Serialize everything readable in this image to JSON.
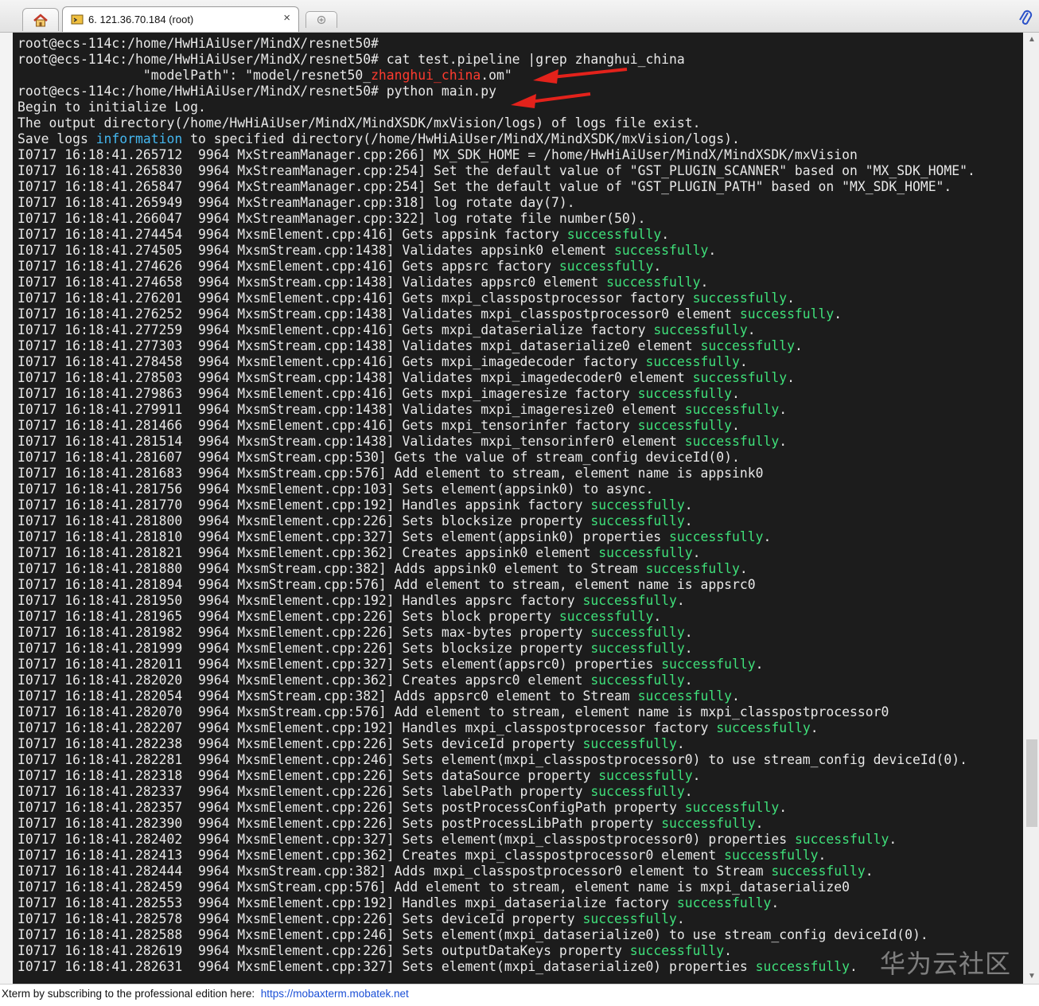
{
  "window": {
    "tabs": [
      {
        "label": "",
        "icon": "home-icon"
      },
      {
        "label": "6. 121.36.70.184 (root)",
        "icon": "terminal-icon",
        "close": "×"
      }
    ],
    "new_tab_icon": "new-tab-icon",
    "attach_icon": "paperclip-icon"
  },
  "colors": {
    "terminal_bg": "#1c1c1c",
    "text": "#e8e8e8",
    "success": "#3fe07a",
    "info": "#44b6ee",
    "highlight": "#ff3b2f",
    "arrow": "#e3221b"
  },
  "terminal": {
    "lines": [
      [
        {
          "t": "root@ecs-114c:/home/HwHiAiUser/MindX/resnet50#"
        }
      ],
      [
        {
          "t": "root@ecs-114c:/home/HwHiAiUser/MindX/resnet50# cat test.pipeline |grep zhanghui_china"
        }
      ],
      [
        {
          "t": "                \"modelPath\": \"model/resnet50_"
        },
        {
          "t": "zhanghui_china",
          "c": "red"
        },
        {
          "t": ".om\""
        }
      ],
      [
        {
          "t": "root@ecs-114c:/home/HwHiAiUser/MindX/resnet50# python main.py"
        }
      ],
      [
        {
          "t": "Begin to initialize Log."
        }
      ],
      [
        {
          "t": "The output directory(/home/HwHiAiUser/MindX/MindXSDK/mxVision/logs) of logs file exist."
        }
      ],
      [
        {
          "t": "Save logs "
        },
        {
          "t": "information",
          "c": "info"
        },
        {
          "t": " to specified directory(/home/HwHiAiUser/MindX/MindXSDK/mxVision/logs)."
        }
      ],
      [
        {
          "t": "I0717 16:18:41.265712  9964 MxStreamManager.cpp:266] MX_SDK_HOME = /home/HwHiAiUser/MindX/MindXSDK/mxVision"
        }
      ],
      [
        {
          "t": "I0717 16:18:41.265830  9964 MxStreamManager.cpp:254] Set the default value of \"GST_PLUGIN_SCANNER\" based on \"MX_SDK_HOME\"."
        }
      ],
      [
        {
          "t": "I0717 16:18:41.265847  9964 MxStreamManager.cpp:254] Set the default value of \"GST_PLUGIN_PATH\" based on \"MX_SDK_HOME\"."
        }
      ],
      [
        {
          "t": "I0717 16:18:41.265949  9964 MxStreamManager.cpp:318] log rotate day(7)."
        }
      ],
      [
        {
          "t": "I0717 16:18:41.266047  9964 MxStreamManager.cpp:322] log rotate file number(50)."
        }
      ],
      [
        {
          "t": "I0717 16:18:41.274454  9964 MxsmElement.cpp:416] Gets appsink factory "
        },
        {
          "t": "successfully",
          "c": "ok"
        },
        {
          "t": "."
        }
      ],
      [
        {
          "t": "I0717 16:18:41.274505  9964 MxsmStream.cpp:1438] Validates appsink0 element "
        },
        {
          "t": "successfully",
          "c": "ok"
        },
        {
          "t": "."
        }
      ],
      [
        {
          "t": "I0717 16:18:41.274626  9964 MxsmElement.cpp:416] Gets appsrc factory "
        },
        {
          "t": "successfully",
          "c": "ok"
        },
        {
          "t": "."
        }
      ],
      [
        {
          "t": "I0717 16:18:41.274658  9964 MxsmStream.cpp:1438] Validates appsrc0 element "
        },
        {
          "t": "successfully",
          "c": "ok"
        },
        {
          "t": "."
        }
      ],
      [
        {
          "t": "I0717 16:18:41.276201  9964 MxsmElement.cpp:416] Gets mxpi_classpostprocessor factory "
        },
        {
          "t": "successfully",
          "c": "ok"
        },
        {
          "t": "."
        }
      ],
      [
        {
          "t": "I0717 16:18:41.276252  9964 MxsmStream.cpp:1438] Validates mxpi_classpostprocessor0 element "
        },
        {
          "t": "successfully",
          "c": "ok"
        },
        {
          "t": "."
        }
      ],
      [
        {
          "t": "I0717 16:18:41.277259  9964 MxsmElement.cpp:416] Gets mxpi_dataserialize factory "
        },
        {
          "t": "successfully",
          "c": "ok"
        },
        {
          "t": "."
        }
      ],
      [
        {
          "t": "I0717 16:18:41.277303  9964 MxsmStream.cpp:1438] Validates mxpi_dataserialize0 element "
        },
        {
          "t": "successfully",
          "c": "ok"
        },
        {
          "t": "."
        }
      ],
      [
        {
          "t": "I0717 16:18:41.278458  9964 MxsmElement.cpp:416] Gets mxpi_imagedecoder factory "
        },
        {
          "t": "successfully",
          "c": "ok"
        },
        {
          "t": "."
        }
      ],
      [
        {
          "t": "I0717 16:18:41.278503  9964 MxsmStream.cpp:1438] Validates mxpi_imagedecoder0 element "
        },
        {
          "t": "successfully",
          "c": "ok"
        },
        {
          "t": "."
        }
      ],
      [
        {
          "t": "I0717 16:18:41.279863  9964 MxsmElement.cpp:416] Gets mxpi_imageresize factory "
        },
        {
          "t": "successfully",
          "c": "ok"
        },
        {
          "t": "."
        }
      ],
      [
        {
          "t": "I0717 16:18:41.279911  9964 MxsmStream.cpp:1438] Validates mxpi_imageresize0 element "
        },
        {
          "t": "successfully",
          "c": "ok"
        },
        {
          "t": "."
        }
      ],
      [
        {
          "t": "I0717 16:18:41.281466  9964 MxsmElement.cpp:416] Gets mxpi_tensorinfer factory "
        },
        {
          "t": "successfully",
          "c": "ok"
        },
        {
          "t": "."
        }
      ],
      [
        {
          "t": "I0717 16:18:41.281514  9964 MxsmStream.cpp:1438] Validates mxpi_tensorinfer0 element "
        },
        {
          "t": "successfully",
          "c": "ok"
        },
        {
          "t": "."
        }
      ],
      [
        {
          "t": "I0717 16:18:41.281607  9964 MxsmStream.cpp:530] Gets the value of stream_config deviceId(0)."
        }
      ],
      [
        {
          "t": "I0717 16:18:41.281683  9964 MxsmStream.cpp:576] Add element to stream, element name is appsink0"
        }
      ],
      [
        {
          "t": "I0717 16:18:41.281756  9964 MxsmElement.cpp:103] Sets element(appsink0) to async."
        }
      ],
      [
        {
          "t": "I0717 16:18:41.281770  9964 MxsmElement.cpp:192] Handles appsink factory "
        },
        {
          "t": "successfully",
          "c": "ok"
        },
        {
          "t": "."
        }
      ],
      [
        {
          "t": "I0717 16:18:41.281800  9964 MxsmElement.cpp:226] Sets blocksize property "
        },
        {
          "t": "successfully",
          "c": "ok"
        },
        {
          "t": "."
        }
      ],
      [
        {
          "t": "I0717 16:18:41.281810  9964 MxsmElement.cpp:327] Sets element(appsink0) properties "
        },
        {
          "t": "successfully",
          "c": "ok"
        },
        {
          "t": "."
        }
      ],
      [
        {
          "t": "I0717 16:18:41.281821  9964 MxsmElement.cpp:362] Creates appsink0 element "
        },
        {
          "t": "successfully",
          "c": "ok"
        },
        {
          "t": "."
        }
      ],
      [
        {
          "t": "I0717 16:18:41.281880  9964 MxsmStream.cpp:382] Adds appsink0 element to Stream "
        },
        {
          "t": "successfully",
          "c": "ok"
        },
        {
          "t": "."
        }
      ],
      [
        {
          "t": "I0717 16:18:41.281894  9964 MxsmStream.cpp:576] Add element to stream, element name is appsrc0"
        }
      ],
      [
        {
          "t": "I0717 16:18:41.281950  9964 MxsmElement.cpp:192] Handles appsrc factory "
        },
        {
          "t": "successfully",
          "c": "ok"
        },
        {
          "t": "."
        }
      ],
      [
        {
          "t": "I0717 16:18:41.281965  9964 MxsmElement.cpp:226] Sets block property "
        },
        {
          "t": "successfully",
          "c": "ok"
        },
        {
          "t": "."
        }
      ],
      [
        {
          "t": "I0717 16:18:41.281982  9964 MxsmElement.cpp:226] Sets max-bytes property "
        },
        {
          "t": "successfully",
          "c": "ok"
        },
        {
          "t": "."
        }
      ],
      [
        {
          "t": "I0717 16:18:41.281999  9964 MxsmElement.cpp:226] Sets blocksize property "
        },
        {
          "t": "successfully",
          "c": "ok"
        },
        {
          "t": "."
        }
      ],
      [
        {
          "t": "I0717 16:18:41.282011  9964 MxsmElement.cpp:327] Sets element(appsrc0) properties "
        },
        {
          "t": "successfully",
          "c": "ok"
        },
        {
          "t": "."
        }
      ],
      [
        {
          "t": "I0717 16:18:41.282020  9964 MxsmElement.cpp:362] Creates appsrc0 element "
        },
        {
          "t": "successfully",
          "c": "ok"
        },
        {
          "t": "."
        }
      ],
      [
        {
          "t": "I0717 16:18:41.282054  9964 MxsmStream.cpp:382] Adds appsrc0 element to Stream "
        },
        {
          "t": "successfully",
          "c": "ok"
        },
        {
          "t": "."
        }
      ],
      [
        {
          "t": "I0717 16:18:41.282070  9964 MxsmStream.cpp:576] Add element to stream, element name is mxpi_classpostprocessor0"
        }
      ],
      [
        {
          "t": "I0717 16:18:41.282207  9964 MxsmElement.cpp:192] Handles mxpi_classpostprocessor factory "
        },
        {
          "t": "successfully",
          "c": "ok"
        },
        {
          "t": "."
        }
      ],
      [
        {
          "t": "I0717 16:18:41.282238  9964 MxsmElement.cpp:226] Sets deviceId property "
        },
        {
          "t": "successfully",
          "c": "ok"
        },
        {
          "t": "."
        }
      ],
      [
        {
          "t": "I0717 16:18:41.282281  9964 MxsmElement.cpp:246] Sets element(mxpi_classpostprocessor0) to use stream_config deviceId(0)."
        }
      ],
      [
        {
          "t": "I0717 16:18:41.282318  9964 MxsmElement.cpp:226] Sets dataSource property "
        },
        {
          "t": "successfully",
          "c": "ok"
        },
        {
          "t": "."
        }
      ],
      [
        {
          "t": "I0717 16:18:41.282337  9964 MxsmElement.cpp:226] Sets labelPath property "
        },
        {
          "t": "successfully",
          "c": "ok"
        },
        {
          "t": "."
        }
      ],
      [
        {
          "t": "I0717 16:18:41.282357  9964 MxsmElement.cpp:226] Sets postProcessConfigPath property "
        },
        {
          "t": "successfully",
          "c": "ok"
        },
        {
          "t": "."
        }
      ],
      [
        {
          "t": "I0717 16:18:41.282390  9964 MxsmElement.cpp:226] Sets postProcessLibPath property "
        },
        {
          "t": "successfully",
          "c": "ok"
        },
        {
          "t": "."
        }
      ],
      [
        {
          "t": "I0717 16:18:41.282402  9964 MxsmElement.cpp:327] Sets element(mxpi_classpostprocessor0) properties "
        },
        {
          "t": "successfully",
          "c": "ok"
        },
        {
          "t": "."
        }
      ],
      [
        {
          "t": "I0717 16:18:41.282413  9964 MxsmElement.cpp:362] Creates mxpi_classpostprocessor0 element "
        },
        {
          "t": "successfully",
          "c": "ok"
        },
        {
          "t": "."
        }
      ],
      [
        {
          "t": "I0717 16:18:41.282444  9964 MxsmStream.cpp:382] Adds mxpi_classpostprocessor0 element to Stream "
        },
        {
          "t": "successfully",
          "c": "ok"
        },
        {
          "t": "."
        }
      ],
      [
        {
          "t": "I0717 16:18:41.282459  9964 MxsmStream.cpp:576] Add element to stream, element name is mxpi_dataserialize0"
        }
      ],
      [
        {
          "t": "I0717 16:18:41.282553  9964 MxsmElement.cpp:192] Handles mxpi_dataserialize factory "
        },
        {
          "t": "successfully",
          "c": "ok"
        },
        {
          "t": "."
        }
      ],
      [
        {
          "t": "I0717 16:18:41.282578  9964 MxsmElement.cpp:226] Sets deviceId property "
        },
        {
          "t": "successfully",
          "c": "ok"
        },
        {
          "t": "."
        }
      ],
      [
        {
          "t": "I0717 16:18:41.282588  9964 MxsmElement.cpp:246] Sets element(mxpi_dataserialize0) to use stream_config deviceId(0)."
        }
      ],
      [
        {
          "t": "I0717 16:18:41.282619  9964 MxsmElement.cpp:226] Sets outputDataKeys property "
        },
        {
          "t": "successfully",
          "c": "ok"
        },
        {
          "t": "."
        }
      ],
      [
        {
          "t": "I0717 16:18:41.282631  9964 MxsmElement.cpp:327] Sets element(mxpi_dataserialize0) properties "
        },
        {
          "t": "successfully",
          "c": "ok"
        },
        {
          "t": "."
        }
      ]
    ]
  },
  "watermark": "华为云社区",
  "statusbar": {
    "text": "Xterm by subscribing to the professional edition here:  ",
    "link": "https://mobaxterm.mobatek.net"
  }
}
